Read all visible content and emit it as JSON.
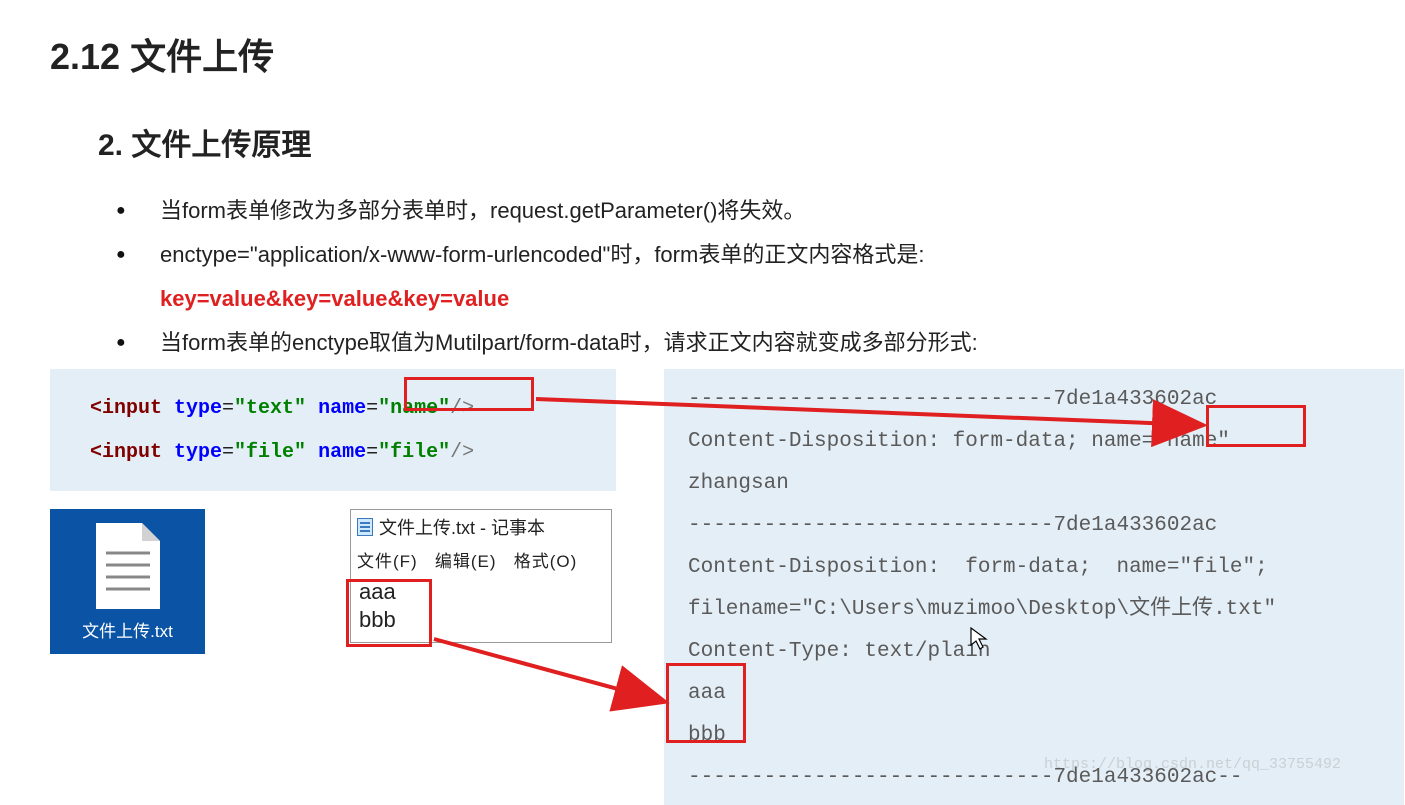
{
  "heading": "2.12 文件上传",
  "subheading": "2. 文件上传原理",
  "bullets": {
    "b1": "当form表单修改为多部分表单时，request.getParameter()将失效。",
    "b2": "enctype=\"application/x-www-form-urlencoded\"时，form表单的正文内容格式是:",
    "b2_red": "key=value&key=value&key=value",
    "b3": "当form表单的enctype取值为Mutilpart/form-data时，请求正文内容就变成多部分形式:"
  },
  "code_left": {
    "l1_open": "<input ",
    "type_kw": "type",
    "eq": "=",
    "text_val": "\"text\"",
    "name_kw": " name",
    "name_val": "\"name\"",
    "close": "/>",
    "file_val_type": "\"file\"",
    "file_val_name": "\"file\""
  },
  "code_right": {
    "l1": "-----------------------------7de1a433602ac",
    "l2a": "Content-Disposition: form-data; name=",
    "l2b": "\"name\"",
    "l3": "zhangsan",
    "l4": "-----------------------------7de1a433602ac",
    "l5": "Content-Disposition:  form-data;  name=\"file\";",
    "l6": "filename=\"C:\\Users\\muzimoo\\Desktop\\文件上传.txt\"",
    "l7": "Content-Type: text/plain",
    "l8": "aaa",
    "l9": "bbb",
    "l10": "-----------------------------7de1a433602ac--"
  },
  "file_icon_label": "文件上传.txt",
  "notepad": {
    "title": "文件上传.txt - 记事本",
    "menu1": "文件(F)",
    "menu2": "编辑(E)",
    "menu3": "格式(O)",
    "line1": "aaa",
    "line2": "bbb"
  },
  "watermark": "https://blog.csdn.net/qq_33755492"
}
